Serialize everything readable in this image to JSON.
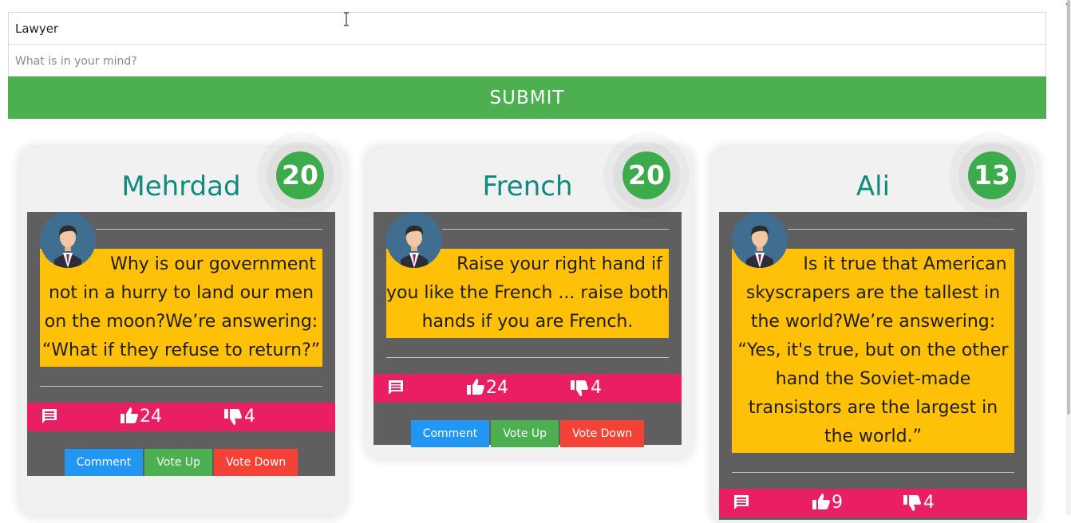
{
  "form": {
    "title_value": "Lawyer",
    "message_placeholder": "What is in your mind?",
    "submit_label": "SUBMIT"
  },
  "posts": [
    {
      "name": "Mehrdad",
      "score": "20",
      "text": "Why is our government not in a hurry to land our men on the moon?We’re answering: “What if they refuse to return?”",
      "likes": "24",
      "dislikes": "4",
      "comment_label": "Comment",
      "vote_up_label": "Vote Up",
      "vote_down_label": "Vote Down"
    },
    {
      "name": "French",
      "score": "20",
      "text": "Raise your right hand if you like the French ... raise both hands if you are French.",
      "likes": "24",
      "dislikes": "4",
      "comment_label": "Comment",
      "vote_up_label": "Vote Up",
      "vote_down_label": "Vote Down"
    },
    {
      "name": "Ali",
      "score": "13",
      "text": "Is it true that American skyscrapers are the tallest in the world?We’re answering: “Yes, it's true, but on the other hand the Soviet-made transistors are the largest in the world.”",
      "likes": "9",
      "dislikes": "4"
    }
  ],
  "icons": {
    "avatar": "avatar-icon",
    "comment": "comment-icon",
    "like": "thumbs-up-icon",
    "dislike": "thumbs-down-icon"
  },
  "colors": {
    "submit": "#4caf50",
    "name": "#0e8a7e",
    "score": "#3cab4b",
    "quote": "#ffc107",
    "bar": "#e91e63",
    "comment_button": "#2196f3",
    "vote_up_button": "#4caf50",
    "vote_down_button": "#f44336"
  }
}
